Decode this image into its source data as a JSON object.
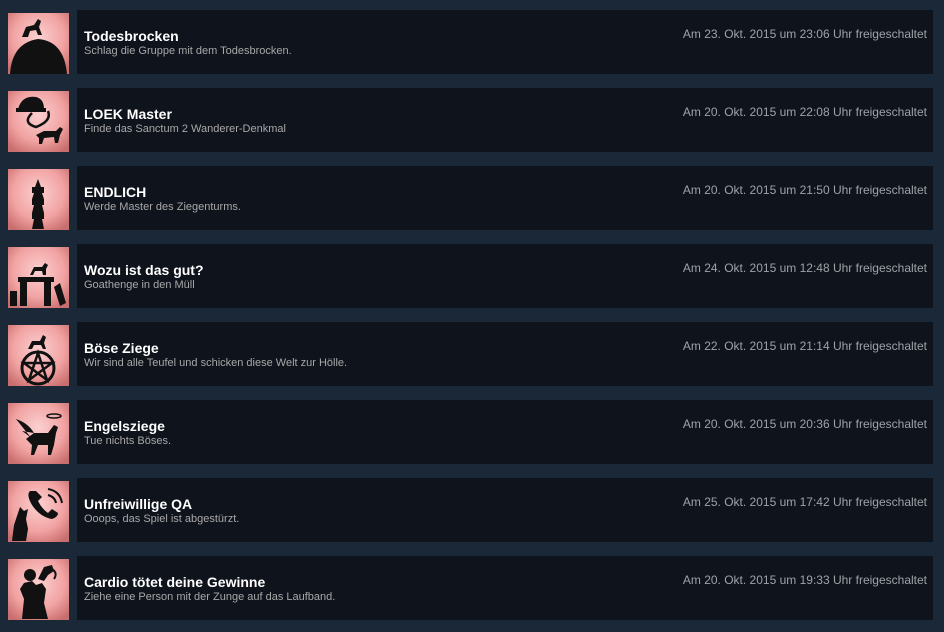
{
  "achievements": [
    {
      "icon": "rock-goat-icon",
      "title": "Todesbrocken",
      "description": "Schlag die Gruppe mit dem Todesbrocken.",
      "unlocked": "Am 23. Okt. 2015 um 23:06 Uhr freigeschaltet"
    },
    {
      "icon": "helmet-goat-icon",
      "title": "LOEK Master",
      "description": "Finde das Sanctum 2 Wanderer-Denkmal",
      "unlocked": "Am 20. Okt. 2015 um 22:08 Uhr freigeschaltet"
    },
    {
      "icon": "tower-icon",
      "title": "ENDLICH",
      "description": "Werde Master des Ziegenturms.",
      "unlocked": "Am 20. Okt. 2015 um 21:50 Uhr freigeschaltet"
    },
    {
      "icon": "goathenge-icon",
      "title": "Wozu ist das gut?",
      "description": "Goathenge in den Müll",
      "unlocked": "Am 24. Okt. 2015 um 12:48 Uhr freigeschaltet"
    },
    {
      "icon": "pentagram-goat-icon",
      "title": "Böse Ziege",
      "description": "Wir sind alle Teufel und schicken diese Welt zur Hölle.",
      "unlocked": "Am 22. Okt. 2015 um 21:14 Uhr freigeschaltet"
    },
    {
      "icon": "winged-goat-icon",
      "title": "Engelsziege",
      "description": "Tue nichts Böses.",
      "unlocked": "Am 20. Okt. 2015 um 20:36 Uhr freigeschaltet"
    },
    {
      "icon": "phone-cat-icon",
      "title": "Unfreiwillige QA",
      "description": "Ooops, das Spiel ist abgestürzt.",
      "unlocked": "Am 25. Okt. 2015 um 17:42 Uhr freigeschaltet"
    },
    {
      "icon": "tongue-goat-icon",
      "title": "Cardio tötet deine Gewinne",
      "description": "Ziehe eine Person mit der Zunge auf das Laufband.",
      "unlocked": "Am 20. Okt. 2015 um 19:33 Uhr freigeschaltet"
    }
  ],
  "colors": {
    "page_bg": "#1b2838",
    "panel_bg": "#0f131c",
    "icon_pink": "#f3a6a6",
    "title": "#ffffff",
    "desc": "#a8a8a8",
    "date": "#9ea3a8"
  }
}
